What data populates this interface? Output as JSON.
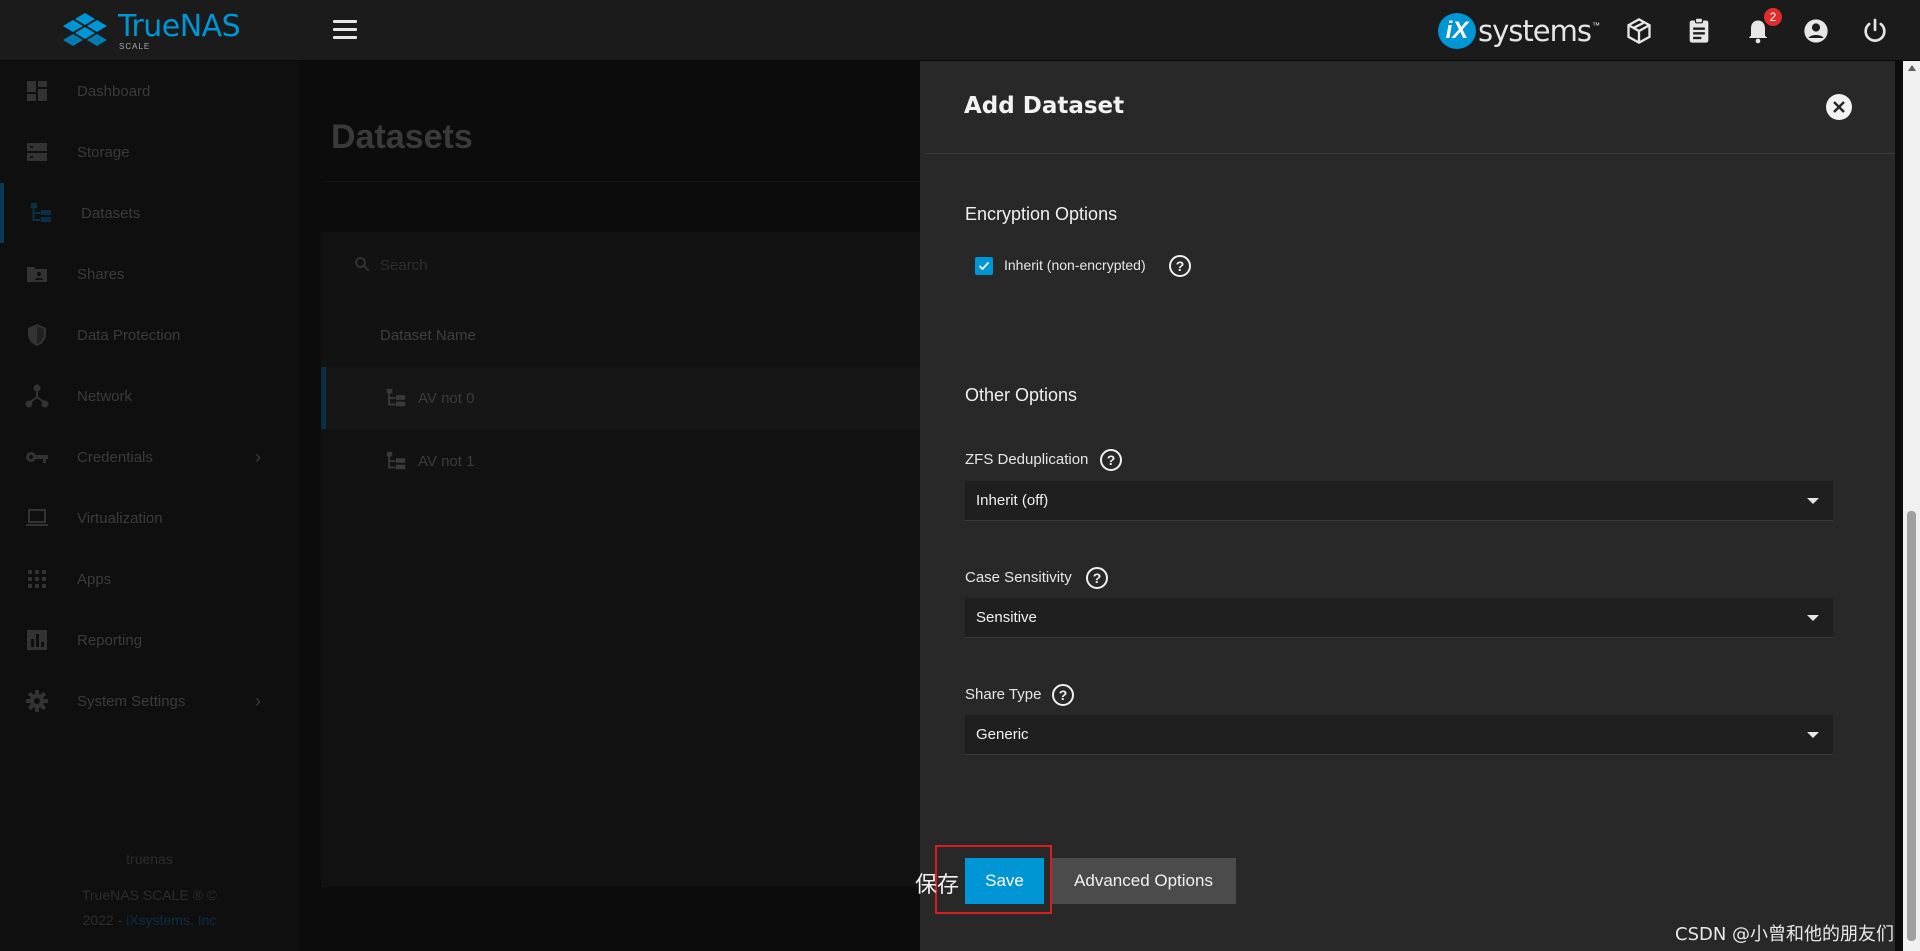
{
  "brand": {
    "name": "TrueNAS",
    "edition": "SCALE",
    "vendor_mark": "iX",
    "vendor_text": "systems",
    "vendor_tm": "™"
  },
  "notifications": {
    "count": "2"
  },
  "sidebar": {
    "items": [
      {
        "label": "Dashboard"
      },
      {
        "label": "Storage"
      },
      {
        "label": "Datasets"
      },
      {
        "label": "Shares"
      },
      {
        "label": "Data Protection"
      },
      {
        "label": "Network"
      },
      {
        "label": "Credentials"
      },
      {
        "label": "Virtualization"
      },
      {
        "label": "Apps"
      },
      {
        "label": "Reporting"
      },
      {
        "label": "System Settings"
      }
    ],
    "hostname": "truenas",
    "copyright": "TrueNAS SCALE ® ©",
    "copyright_year": "2022 - ",
    "copyright_link": "iXsystems, Inc"
  },
  "main": {
    "title": "Datasets",
    "search_placeholder": "Search",
    "column_header": "Dataset Name",
    "rows": [
      {
        "name": "AV not 0"
      },
      {
        "name": "AV not 1"
      }
    ]
  },
  "panel": {
    "title": "Add Dataset",
    "encryption": {
      "section": "Encryption Options",
      "inherit_label": "Inherit (non-encrypted)",
      "inherit_checked": true
    },
    "other": {
      "section": "Other Options",
      "dedup_label": "ZFS Deduplication",
      "dedup_value": "Inherit (off)",
      "case_label": "Case Sensitivity",
      "case_value": "Sensitive",
      "share_label": "Share Type",
      "share_value": "Generic"
    },
    "save_label": "Save",
    "advanced_label": "Advanced Options"
  },
  "annotation": {
    "text": "保存"
  },
  "watermark": "CSDN @小曾和他的朋友们",
  "colors": {
    "accent": "#0095d5",
    "panel": "#282828",
    "annotation": "#d91e1e"
  }
}
